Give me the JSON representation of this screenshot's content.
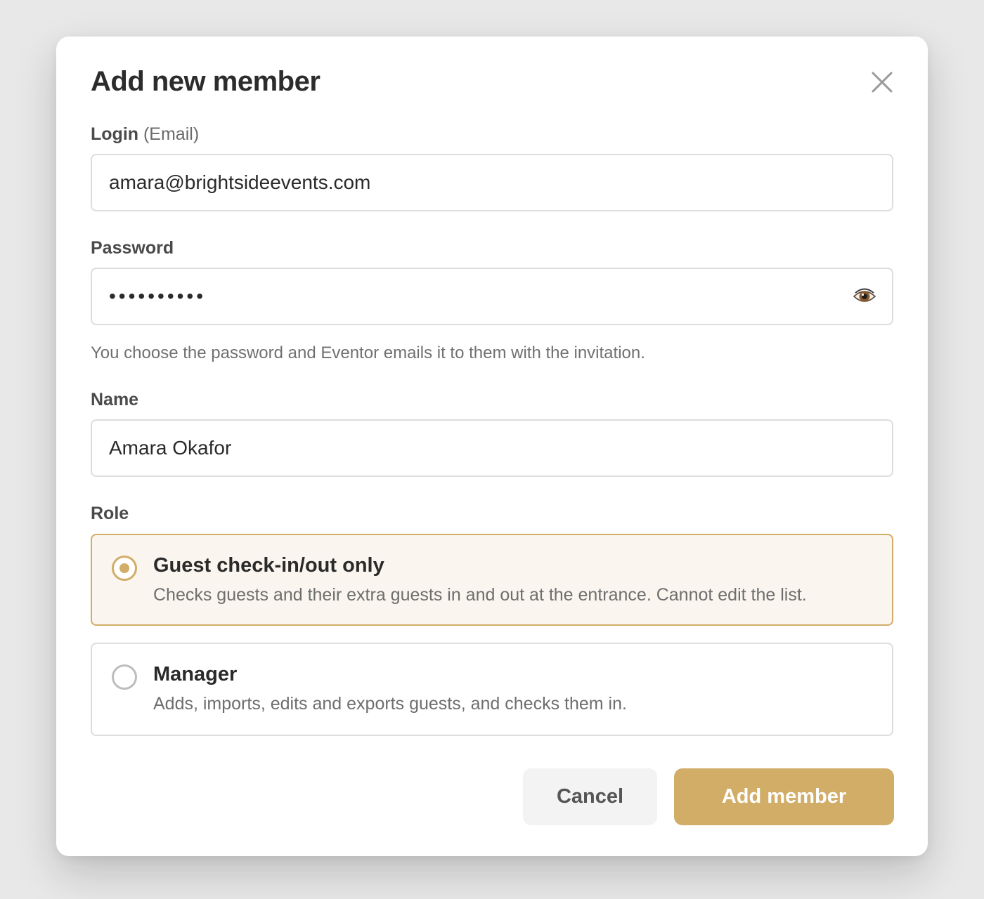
{
  "modal": {
    "title": "Add new member",
    "close_icon": "close-icon"
  },
  "login": {
    "label": "Login",
    "label_sub": "(Email)",
    "value": "amara@brightsideevents.com"
  },
  "password": {
    "label": "Password",
    "value": "••••••••••",
    "toggle_icon": "eye-icon",
    "hint": "You choose the password and Eventor emails it to them with the invitation."
  },
  "name": {
    "label": "Name",
    "value": "Amara Okafor"
  },
  "role": {
    "label": "Role",
    "options": [
      {
        "title": "Guest check-in/out only",
        "description": "Checks guests and their extra guests in and out at the entrance. Cannot edit the list.",
        "selected": true
      },
      {
        "title": "Manager",
        "description": "Adds, imports, edits and exports guests, and checks them in.",
        "selected": false
      }
    ]
  },
  "actions": {
    "cancel_label": "Cancel",
    "submit_label": "Add member"
  },
  "colors": {
    "accent": "#d1ad68",
    "selected_bg": "#faf6ef",
    "border": "#dddddd",
    "text_dark": "#2c2c2c"
  }
}
